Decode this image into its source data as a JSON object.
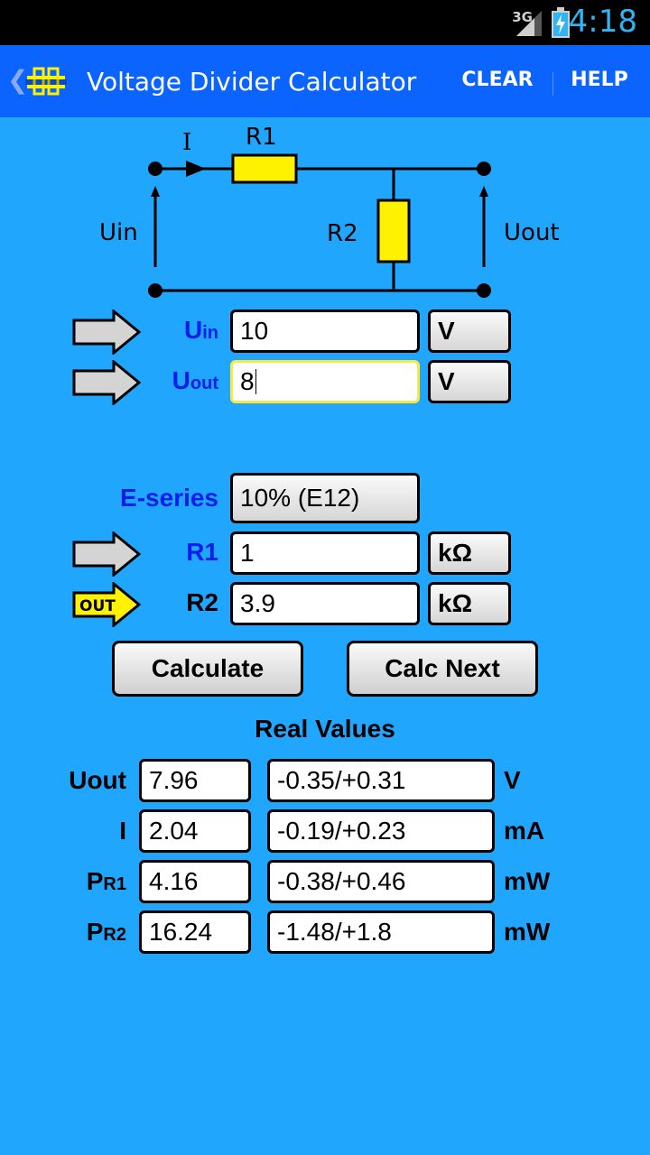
{
  "status_bar": {
    "network": "3G",
    "time": "4:18"
  },
  "action_bar": {
    "title": "Voltage Divider Calculator",
    "clear_label": "CLEAR",
    "help_label": "HELP"
  },
  "circuit": {
    "current_label": "I",
    "r1_label": "R1",
    "r2_label": "R2",
    "uin_label": "Uin",
    "uout_label": "Uout"
  },
  "inputs": {
    "uin": {
      "label_main": "U",
      "label_sub": "in",
      "value": "10",
      "unit": "V"
    },
    "uout": {
      "label_main": "U",
      "label_sub": "out",
      "value": "8",
      "unit": "V"
    }
  },
  "eseries": {
    "label": "E-series",
    "value": "10% (E12)"
  },
  "resistors": {
    "r1": {
      "label": "R1",
      "value": "1",
      "unit": "kΩ"
    },
    "r2": {
      "label": "R2",
      "value": "3.9",
      "unit": "kΩ",
      "badge": "OUT"
    }
  },
  "buttons": {
    "calculate": "Calculate",
    "calc_next": "Calc Next"
  },
  "real_values": {
    "title": "Real Values",
    "rows": [
      {
        "label_main": "Uout",
        "label_sub": "",
        "value": "7.96",
        "tolerance": "-0.35/+0.31",
        "unit": "V"
      },
      {
        "label_main": "I",
        "label_sub": "",
        "value": "2.04",
        "tolerance": "-0.19/+0.23",
        "unit": "mA"
      },
      {
        "label_main": "P",
        "label_sub": "R1",
        "value": "4.16",
        "tolerance": "-0.38/+0.46",
        "unit": "mW"
      },
      {
        "label_main": "P",
        "label_sub": "R2",
        "value": "16.24",
        "tolerance": "-1.48/+1.8",
        "unit": "mW"
      }
    ]
  },
  "colors": {
    "background": "#21A6FE",
    "action_bar": "#0A64FD",
    "label_blue": "#0A1EEB",
    "resistor_yellow": "#FFF200",
    "active_border": "#FFE73A"
  }
}
